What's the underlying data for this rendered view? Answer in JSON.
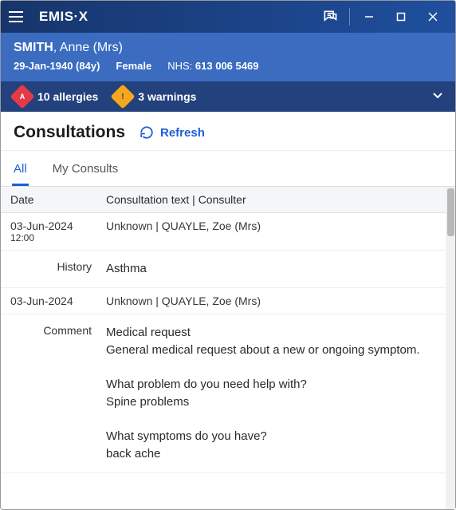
{
  "app": {
    "name": "EMIS·X"
  },
  "patient": {
    "surname": "SMITH",
    "rest": ", Anne (Mrs)",
    "dob": "29-Jan-1940 (84y)",
    "gender": "Female",
    "nhs_label": "NHS:",
    "nhs_number": "613 006 5469"
  },
  "alerts": {
    "allergies": "10 allergies",
    "warnings": "3 warnings"
  },
  "page": {
    "title": "Consultations",
    "refresh": "Refresh"
  },
  "tabs": {
    "all": "All",
    "my": "My Consults"
  },
  "table": {
    "head_date": "Date",
    "head_main": "Consultation text | Consulter",
    "rows": [
      {
        "date": "03-Jun-2024",
        "time": "12:00",
        "main": "Unknown | QUAYLE, Zoe (Mrs)",
        "detail_label": "History",
        "detail": "Asthma"
      },
      {
        "date": "03-Jun-2024",
        "time": "",
        "main": "Unknown | QUAYLE, Zoe (Mrs)",
        "detail_label": "Comment",
        "detail": "Medical request\nGeneral medical request about a new or ongoing symptom.\n\nWhat problem do you need help with?\nSpine problems\n\nWhat symptoms do you have?\nback ache"
      }
    ]
  }
}
